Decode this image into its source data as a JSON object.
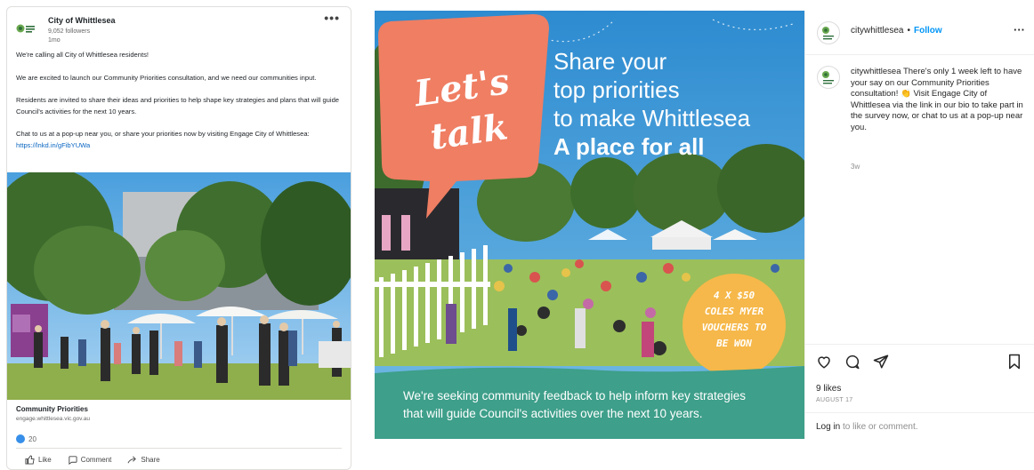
{
  "linkedin": {
    "org_name": "City of Whittlesea",
    "followers": "9,052 followers",
    "time": "1mo",
    "paragraphs": [
      "We're calling all City of Whittlesea residents!",
      "We are excited to launch our Community Priorities consultation, and we need our communities input.",
      "Residents are invited to share their ideas and priorities to help shape key strategies and plans that will guide Council's activities for the next 10 years."
    ],
    "cta_text": "Chat to us at a pop-up near you, or share your priorities now by visiting Engage City of Whittlesea: ",
    "cta_link": "https://lnkd.in/gFibYUWa",
    "link_title": "Community Priorities",
    "link_url": "engage.whittlesea.vic.gov.au",
    "reaction_count": "20",
    "actions": {
      "like": "Like",
      "comment": "Comment",
      "share": "Share"
    },
    "logo_text": "City of Whittlesea"
  },
  "instagram_image": {
    "bubble_text_1": "Let's",
    "bubble_text_2": "talk",
    "headline_1": "Share your",
    "headline_2": "top priorities",
    "headline_3": "to make Whittlesea",
    "headline_4": "A place for all",
    "badge_lines": [
      "4 X $50",
      "COLES MYER",
      "VOUCHERS TO",
      "BE WON"
    ],
    "footer_1": "We're seeking community feedback to help inform key strategies",
    "footer_2": "that will guide Council's activities over the next 10 years.",
    "colors": {
      "bubble": "#ef7e63",
      "sky": "#3f9bd7",
      "footer": "#3e9f8a",
      "badge": "#f6b84a"
    }
  },
  "instagram_panel": {
    "username": "citywhittlesea",
    "separator": "•",
    "follow_label": "Follow",
    "caption_user": "citywhittlesea",
    "caption": "There's only 1 week left to have your say on our Community Priorities consultation! 👏 Visit Engage City of Whittlesea via the link in our bio to take part in the survey now, or chat to us at a pop-up near you.",
    "age": "3w",
    "likes": "9 likes",
    "date": "AUGUST 17",
    "login_link": "Log in",
    "login_rest": " to like or comment.",
    "icons": [
      "heart-icon",
      "comment-icon",
      "share-icon",
      "bookmark-icon"
    ]
  }
}
